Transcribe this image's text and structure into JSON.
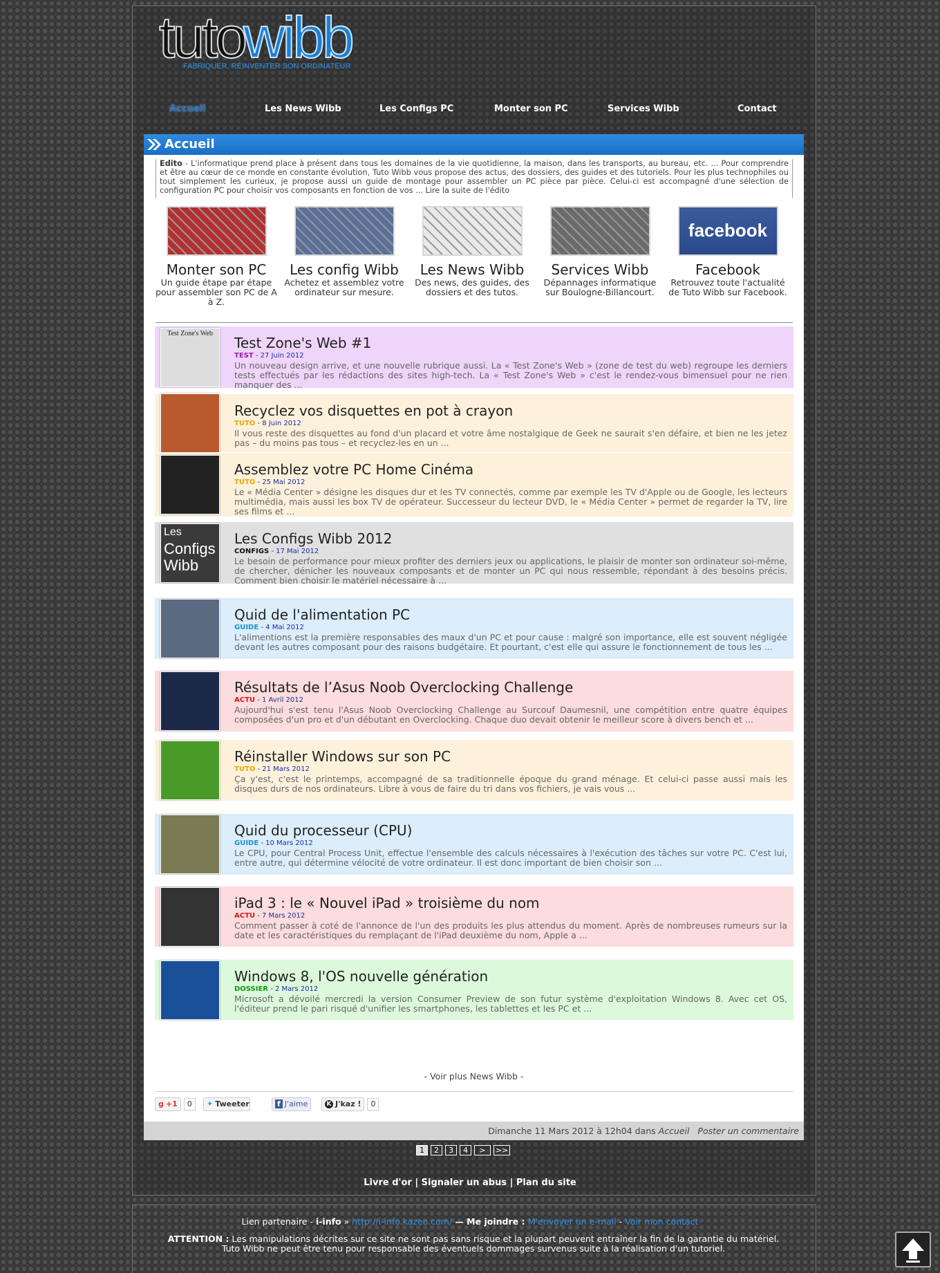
{
  "logo": {
    "part1": "tuto",
    "part2": "wibb",
    "tagline": "Fabriquer, réinventer son ordinateur"
  },
  "nav": [
    {
      "label": "Accueil",
      "active": true
    },
    {
      "label": "Les News Wibb"
    },
    {
      "label": "Les Configs PC"
    },
    {
      "label": "Monter son PC"
    },
    {
      "label": "Services Wibb"
    },
    {
      "label": "Contact"
    }
  ],
  "panel": {
    "title": "Accueil"
  },
  "edito": {
    "label": "Edito",
    "text": " - L'informatique prend place à présent dans tous les domaines de la vie quotidienne, la maison, dans les transports, au bureau, etc. ... Pour comprendre et être au cœur de ce monde en constante évolution, Tuto Wibb vous propose des actus, des dossiers, des guides et des tutoriels. Pour les plus technophiles ou tout simplement les curieux, je propose aussi un guide de montage pour assembler un PC pièce par pièce. Celui-ci est accompagné d'une sélection de configuration PC pour choisir vos composants en fonction de vos ... Lire la suite de l'édito"
  },
  "features": [
    {
      "title": "Monter son PC",
      "desc": "Un guide étape par étape pour assembler son PC de A à Z.",
      "color": "#b43030"
    },
    {
      "title": "Les config Wibb",
      "desc": "Achetez et assemblez votre ordinateur sur mesure.",
      "color": "#5a6f9a"
    },
    {
      "title": "Les News Wibb",
      "desc": "Des news, des guides, des dossiers et des tutos.",
      "color": "#e9e9e9"
    },
    {
      "title": "Services Wibb",
      "desc": "Dépannages informatique sur Boulogne-Billancourt.",
      "color": "#6a6a6a"
    },
    {
      "title": "Facebook",
      "desc": "Retrouvez toute l'actualité de Tuto Wibb sur Facebook.",
      "color": "#2b4a8c",
      "logo": "facebook"
    }
  ],
  "posts": [
    {
      "title": "Test Zone's Web #1",
      "cat": "TEST",
      "catColor": "#9a1db0",
      "date": "27 Juin 2012",
      "bg": "#efd5f9",
      "excerpt": "Un nouveau design arrive, et une nouvelle rubrique aussi. La « Test Zone's Web » (zone de test du web) regroupe les derniers tests effectués par les rédactions des sites high-tech. La « Test Zone's Web » c'est le rendez-vous bimensuel pour ne rien manquer des ...",
      "thumb": "#ddd",
      "thumbText": "Test Zone's Web"
    },
    {
      "title": "Recyclez vos disquettes en pot à crayon",
      "cat": "TUTO",
      "catColor": "#e8a800",
      "date": "8 Juin 2012",
      "bg": "#fef1dc",
      "excerpt": "Il vous reste des disquettes au fond d'un placard et votre âme nostalgique de Geek ne saurait s'en défaire, et bien ne les jetez pas – du moins pas tous – et recyclez-les en un ...",
      "thumb": "#b85a2e"
    },
    {
      "title": "Assemblez votre PC Home Cinéma",
      "cat": "TUTO",
      "catColor": "#e8a800",
      "date": "25 Mai 2012",
      "bg": "#fef1dc",
      "excerpt": "Le « Média Center » désigne les disques dur et les TV connectés, comme par exemple les TV d'Apple ou de Google, les lecteurs multimédia, mais aussi les box TV de opérateur. Successeur du lecteur DVD, le « Média Center » permet de regarder la TV, lire ses films et ...",
      "thumb": "#222"
    },
    {
      "title": "Les Configs Wibb 2012",
      "cat": "CONFIGS",
      "catColor": "#111",
      "date": "17 Mai 2012",
      "bg": "#e0e0e0",
      "excerpt": "Le besoin de performance pour mieux profiter des derniers jeux ou applications, le plaisir de monter son ordinateur soi-même, de chercher, dénicher les nouveaux composants et de monter un PC qui nous ressemble, répondant à des besoins précis. Comment bien choisir le matériel nécessaire à ...",
      "thumb": "#3a3a3a",
      "thumbLines": [
        "Les",
        "Configs",
        "Wibb"
      ]
    },
    {
      "title": "Quid de l'alimentation PC",
      "cat": "GUIDE",
      "catColor": "#1d8fd6",
      "date": "4 Mai 2012",
      "bg": "#dcedfb",
      "excerpt": "L'alimentions est la première responsables des maux d'un PC et pour cause : malgré son importance, elle est souvent négligée devant les autres composant pour des raisons budgétaire. Et pourtant, c'est elle qui assure le fonctionnement de tous les ...",
      "thumb": "#5a6a80"
    },
    {
      "title": "Résultats de l’Asus Noob Overclocking Challenge",
      "cat": "ACTU",
      "catColor": "#d11a1a",
      "date": "1 Avril 2012",
      "bg": "#fcdcdc",
      "excerpt": "Aujourd'hui s'est tenu l'Asus Noob Overclocking Challenge au Surcouf Daumesnil, une compétition entre quatre équipes composées d'un pro et d'un débutant en Overclocking. Chaque duo devait obtenir le meilleur score à divers bench et ...",
      "thumb": "#1c2a4a"
    },
    {
      "title": "Réinstaller Windows sur son PC",
      "cat": "TUTO",
      "catColor": "#e8a800",
      "date": "21 Mars 2012",
      "bg": "#fef1dc",
      "excerpt": "Ça y'est, c'est le printemps, accompagné de sa traditionnelle époque du grand ménage. Et celui-ci passe aussi mais les disques durs de nos ordinateurs. Libre à vous de faire du tri dans vos fichiers, je vais vous ...",
      "thumb": "#4a9a2a"
    },
    {
      "title": "Quid du processeur (CPU)",
      "cat": "GUIDE",
      "catColor": "#1d8fd6",
      "date": "10 Mars 2012",
      "bg": "#dcedfb",
      "excerpt": "Le CPU, pour Central Process Unit, effectue l'ensemble des calculs nécessaires à l'exécution des tâches sur votre PC. C'est lui, entre autre, qui détermine vélocité de votre ordinateur. Il est donc important de bien choisir son ...",
      "thumb": "#7a7a55"
    },
    {
      "title": "iPad 3 : le « Nouvel iPad » troisième du nom",
      "cat": "ACTU",
      "catColor": "#d11a1a",
      "date": "7 Mars 2012",
      "bg": "#fcdcdc",
      "excerpt": "Comment passer à coté de l'annonce de l'un des produits les plus attendus du moment. Après de nombreuses rumeurs sur la date et les caractéristiques du remplaçant de l'iPad deuxième du nom, Apple a ...",
      "thumb": "#333"
    },
    {
      "title": "Windows 8, l'OS nouvelle génération",
      "cat": "DOSSIER",
      "catColor": "#12950e",
      "date": "2 Mars 2012",
      "bg": "#dcf9dc",
      "excerpt": "Microsoft a dévoilé mercredi la version Consumer Preview de son futur système d'exploitation Windows 8. Avec cet OS, l'éditeur prend le pari risqué d'unifier les smartphones, les tablettes et les PC et ...",
      "thumb": "#1a4f9a"
    }
  ],
  "more": "- Voir plus News Wibb -",
  "share": {
    "gplus": "+1",
    "gplus_count": "0",
    "tweet": "Tweeter",
    "fb": "J'aime",
    "jkaz": "J'kaz !",
    "jkaz_count": "0"
  },
  "footer_bar": {
    "date": "Dimanche 11 Mars 2012 à 12h04",
    "in": " dans ",
    "category": "Accueil",
    "comment": "Poster un commentaire"
  },
  "pager": [
    "1",
    "2",
    "3",
    "4",
    ">",
    ">>"
  ],
  "links": "Livre d'or | Signaler un abus | Plan du site",
  "partner": {
    "label": "Lien partenaire - ",
    "name": "i-info",
    "sep": " » ",
    "url": "http://i-info.kazeo.com/",
    "join": " — Me joindre : ",
    "mail": "M'envoyer un e-mail",
    "dash": " - ",
    "contact": "Voir mon contact"
  },
  "attention": {
    "label": "ATTENTION :",
    "line1": " Les manipulations décrites sur ce site ne sont pas sans risque et la plupart peuvent entraîner la fin de la garantie du matériel.",
    "line2": "Tuto Wibb ne peut être tenu pour responsable des éventuels dommages survenus suite à la réalisation d'un tutoriel."
  }
}
